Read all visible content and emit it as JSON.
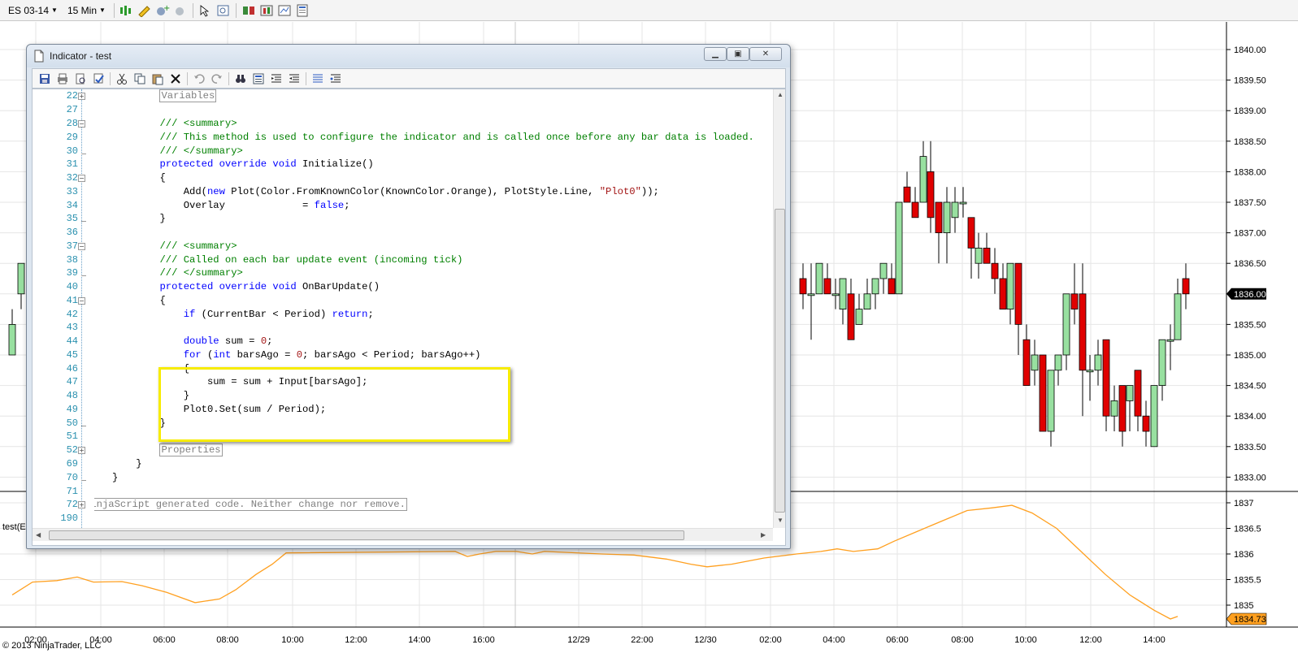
{
  "toolbar": {
    "instrument": "ES 03-14",
    "interval": "15 Min"
  },
  "window": {
    "title": "Indicator - test"
  },
  "gutter": {
    "lines": [
      "22",
      "27",
      "28",
      "29",
      "30",
      "31",
      "32",
      "33",
      "34",
      "35",
      "36",
      "37",
      "38",
      "39",
      "40",
      "41",
      "42",
      "43",
      "44",
      "45",
      "46",
      "47",
      "48",
      "49",
      "50",
      "51",
      "52",
      "69",
      "70",
      "71",
      "72",
      "190"
    ]
  },
  "code": {
    "l22_region": "Variables",
    "l28": "/// <summary>",
    "l29": "/// This method is used to configure the indicator and is called once before any bar data is loaded.",
    "l30": "/// </summary>",
    "l31_kw": "protected override void",
    "l31_rest": " Initialize()",
    "l32": "{",
    "l33_a": "Add(",
    "l33_kw": "new",
    "l33_b": " Plot(Color.FromKnownColor(KnownColor.Orange), PlotStyle.Line, ",
    "l33_str": "\"Plot0\"",
    "l33_c": "));",
    "l34_a": "Overlay             = ",
    "l34_kw": "false",
    "l34_b": ";",
    "l35": "}",
    "l37": "/// <summary>",
    "l38": "/// Called on each bar update event (incoming tick)",
    "l39": "/// </summary>",
    "l40_kw": "protected override void",
    "l40_rest": " OnBarUpdate()",
    "l41": "{",
    "l42_kw1": "if",
    "l42_a": " (CurrentBar < Period) ",
    "l42_kw2": "return",
    "l42_b": ";",
    "l44_kw": "double",
    "l44_a": " sum = ",
    "l44_num": "0",
    "l44_b": ";",
    "l45_kw1": "for",
    "l45_a": " (",
    "l45_kw2": "int",
    "l45_b": " barsAgo = ",
    "l45_num": "0",
    "l45_c": "; barsAgo < Period; barsAgo++)",
    "l46": "{",
    "l47": "sum = sum + Input[barsAgo];",
    "l48": "}",
    "l49": "Plot0.Set(sum / Period);",
    "l50": "}",
    "l52_region": "Properties",
    "l69": "}",
    "l70": "}",
    "l72_region": "NinjaScript generated code. Neither change nor remove."
  },
  "chart": {
    "price_labels": [
      "1840.00",
      "1839.50",
      "1839.00",
      "1838.50",
      "1838.00",
      "1837.50",
      "1837.00",
      "1836.50",
      "1836.00",
      "1835.50",
      "1835.00",
      "1834.50",
      "1834.00",
      "1833.50",
      "1833.00"
    ],
    "current_price": "1836.00",
    "indicator_labels": [
      "1837",
      "1836.5",
      "1836",
      "1835.5",
      "1835"
    ],
    "indicator_current": "1834.73",
    "time_labels": [
      "02:00",
      "04:00",
      "06:00",
      "08:00",
      "10:00",
      "12:00",
      "14:00",
      "16:00",
      "12/29",
      "22:00",
      "12/30",
      "02:00",
      "04:00",
      "06:00",
      "08:00",
      "10:00",
      "12:00",
      "14:00"
    ],
    "panel_label": "test(E",
    "copyright": "© 2013 NinjaTrader, LLC",
    "colors": {
      "up": "#98e0a0",
      "down": "#e00000",
      "line": "#ffa020",
      "price_tag": "#000000",
      "ind_tag": "#ffa020"
    }
  }
}
